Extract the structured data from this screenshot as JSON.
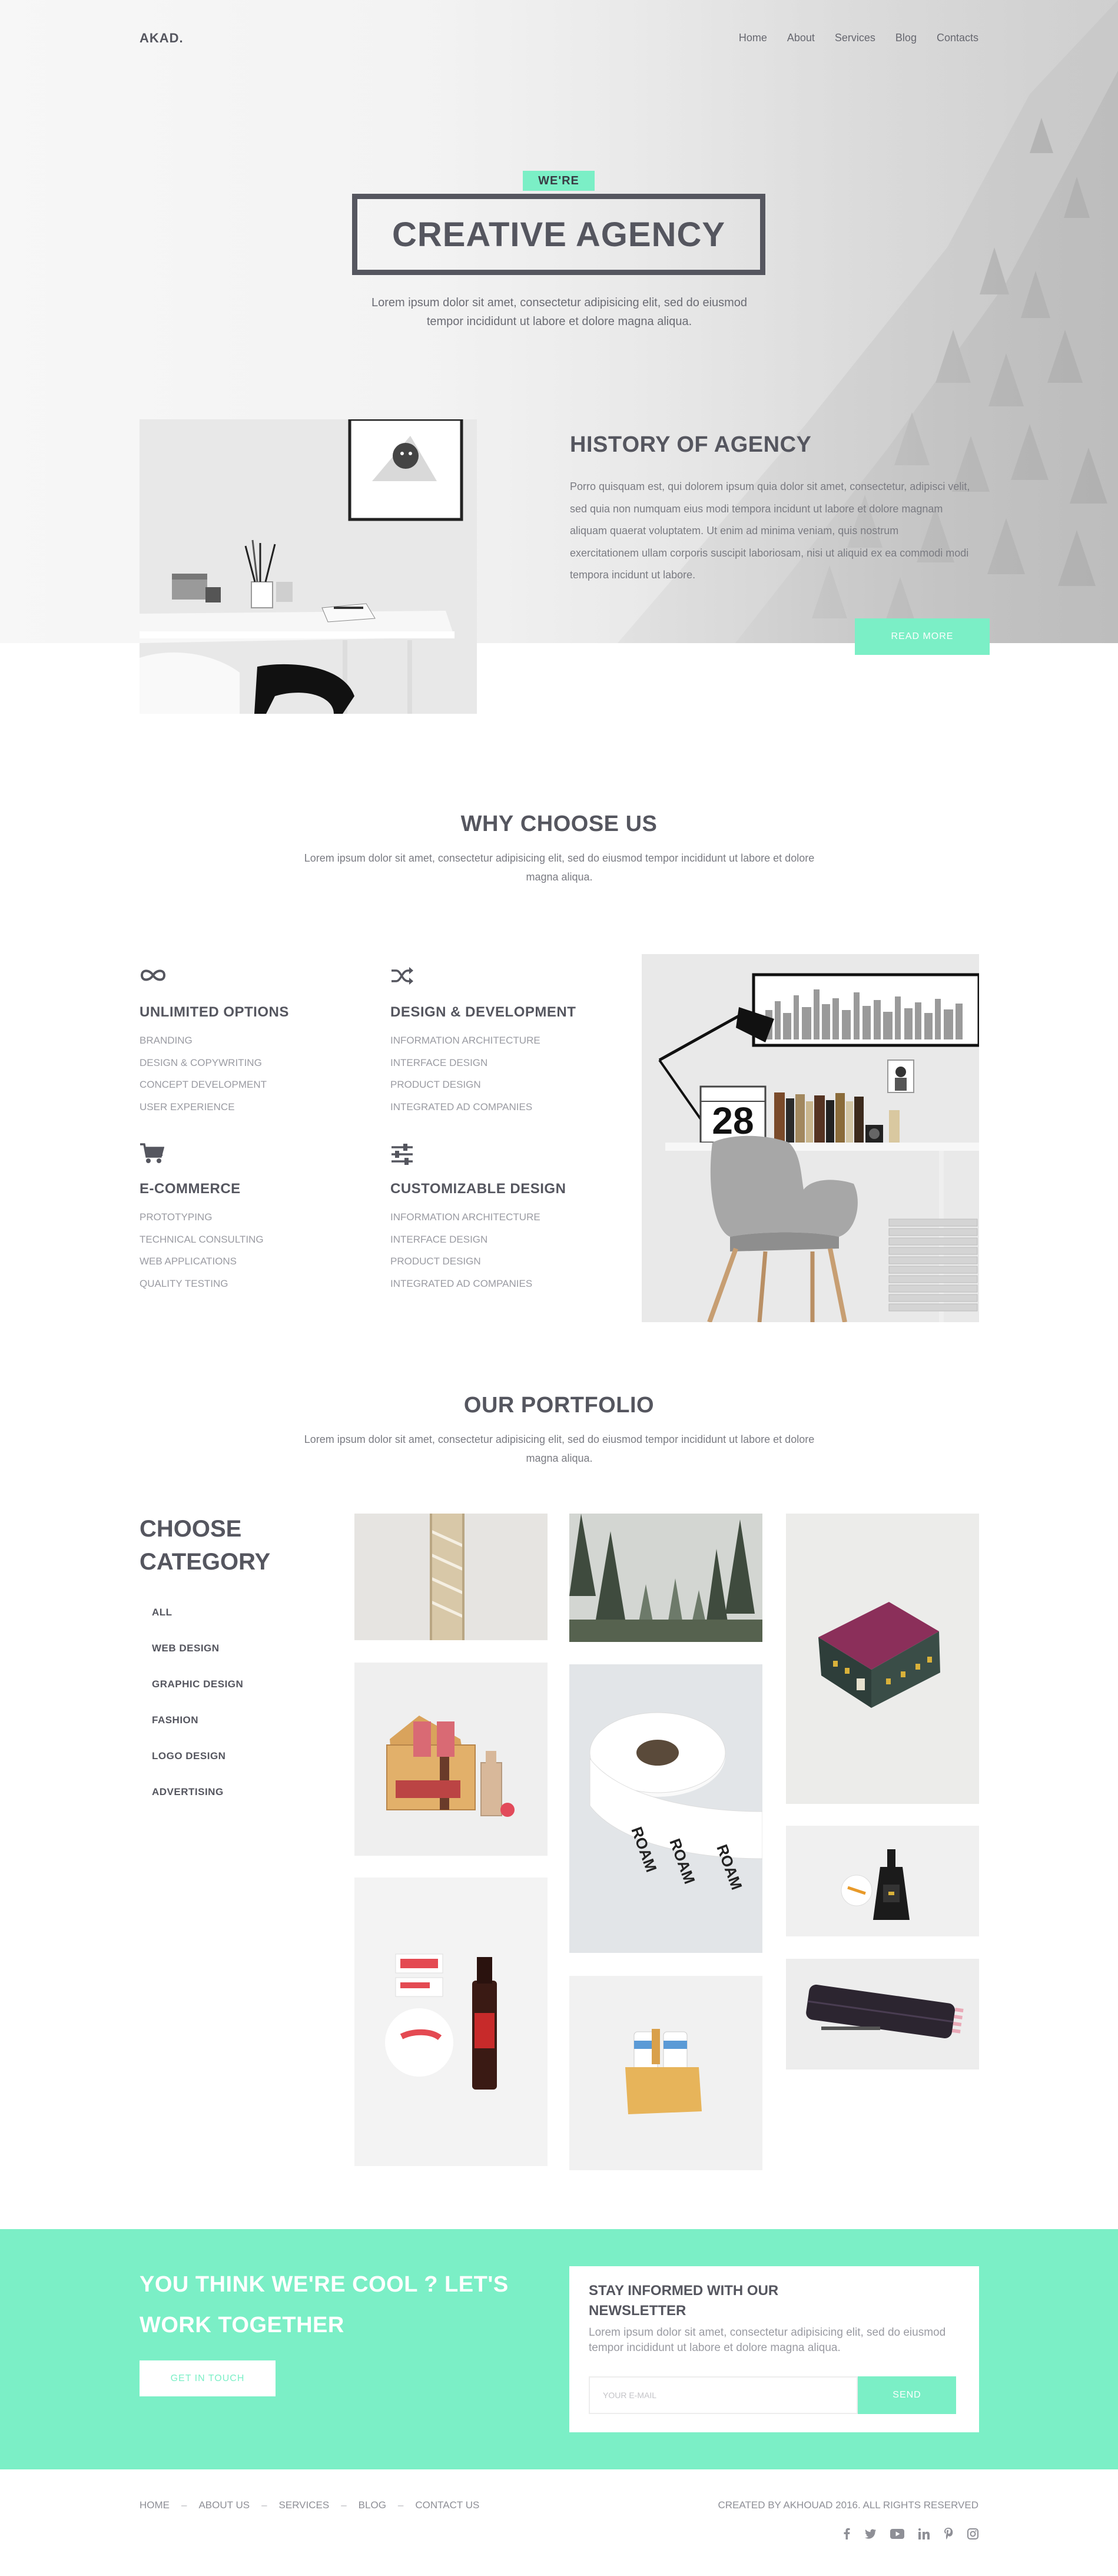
{
  "brand": {
    "logo": "AKAD.",
    "accent": "#7befc6",
    "text": "#55565f"
  },
  "nav": [
    "Home",
    "About",
    "Services",
    "Blog",
    "Contacts"
  ],
  "hero": {
    "tag": "WE'RE",
    "title": "CREATIVE AGENCY",
    "subtitle": "Lorem ipsum dolor sit amet, consectetur adipisicing elit, sed do eiusmod tempor incididunt ut labore et dolore magna aliqua."
  },
  "history": {
    "title_hl": "HIST",
    "title_rest": "ORY OF AGENCY",
    "text": "Porro quisquam est, qui dolorem ipsum quia dolor sit amet, consectetur, adipisci velit, sed quia non numquam eius modi tempora incidunt ut labore et dolore magnam aliquam quaerat voluptatem. Ut enim ad minima veniam, quis nostrum exercitationem ullam corporis suscipit laboriosam, nisi ut aliquid ex ea commodi modi tempora incidunt ut labore.",
    "button": "READ MORE"
  },
  "why": {
    "title_hl": "WHY",
    "title_rest": " CHOOSE US",
    "subtitle": "Lorem ipsum dolor sit amet, consectetur adipisicing elit, sed do eiusmod tempor incididunt ut labore et dolore magna aliqua.",
    "features": [
      {
        "icon": "infinity-icon",
        "title": "UNLIMITED OPTIONS",
        "items": [
          "BRANDING",
          "DESIGN & COPYWRITING",
          "CONCEPT DEVELOPMENT",
          "USER EXPERIENCE"
        ]
      },
      {
        "icon": "shuffle-icon",
        "title": "DESIGN & DEVELOPMENT",
        "items": [
          "INFORMATION ARCHITECTURE",
          "INTERFACE DESIGN",
          "PRODUCT DESIGN",
          "INTEGRATED AD COMPANIES"
        ]
      },
      {
        "icon": "cart-icon",
        "title": "E-COMMERCE",
        "items": [
          "PROTOTYPING",
          "TECHNICAL CONSULTING",
          "WEB APPLICATIONS",
          "QUALITY TESTING"
        ]
      },
      {
        "icon": "sliders-icon",
        "title": "CUSTOMIZABLE DESIGN",
        "items": [
          "INFORMATION ARCHITECTURE",
          "INTERFACE DESIGN",
          "PRODUCT DESIGN",
          "INTEGRATED AD COMPANIES"
        ]
      }
    ],
    "calendar_number": "28"
  },
  "portfolio": {
    "title_hl": "OUR",
    "title_rest": " PORTFOLIO",
    "subtitle": "Lorem ipsum dolor sit amet, consectetur adipisicing elit, sed do eiusmod tempor incididunt ut labore et dolore magna aliqua.",
    "category_line1": "CHOOSE",
    "category_line2": "CATEGORY",
    "categories": [
      "ALL",
      "WEB DESIGN",
      "GRAPHIC DESIGN",
      "FASHION",
      "LOGO DESIGN",
      "ADVERTISING"
    ],
    "tape_text": "ROAM"
  },
  "cta": {
    "line1": "YOU THINK WE'RE COOL ? LET'S",
    "line2": "WORK TOGETHER",
    "button": "GET IN TOUCH"
  },
  "newsletter": {
    "title_line1": "STAY INFORMED WITH OUR",
    "title_line2": "NEWSLETTER",
    "text": "Lorem ipsum dolor sit amet, consectetur adipisicing elit, sed do eiusmod tempor incididunt ut labore et dolore magna aliqua.",
    "placeholder": "YOUR E-MAIL",
    "button": "SEND"
  },
  "footer": {
    "links": [
      "HOME",
      "ABOUT US",
      "SERVICES",
      "BLOG",
      "CONTACT US"
    ],
    "copyright": "CREATED BY AKHOUAD 2016. ALL RIGHTS RESERVED",
    "social": [
      "facebook-icon",
      "twitter-icon",
      "youtube-icon",
      "linkedin-icon",
      "pinterest-icon",
      "instagram-icon"
    ]
  }
}
